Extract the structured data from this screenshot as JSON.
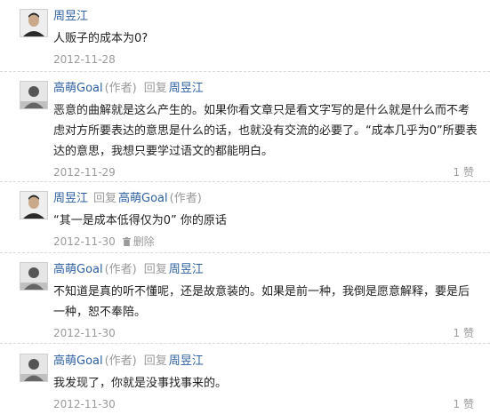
{
  "comments": [
    {
      "author": "周昱江",
      "role": "",
      "reply_word": "",
      "reply_to": "",
      "reply_to_role": "",
      "text": "人贩子的成本为0?",
      "date": "2012-11-28",
      "delete_label": "",
      "likes": ""
    },
    {
      "author": "高萌Goal",
      "role": "(作者)",
      "reply_word": "回复",
      "reply_to": "周昱江",
      "reply_to_role": "",
      "text": "恶意的曲解就是这么产生的。如果你看文章只是看文字写的是什么就是什么而不考虑对方所要表达的意思是什么的话，也就没有交流的必要了。“成本几乎为0”所要表达的意思，我想只要学过语文的都能明白。",
      "date": "2012-11-29",
      "delete_label": "",
      "likes": "1 赞"
    },
    {
      "author": "周昱江",
      "role": "",
      "reply_word": "回复",
      "reply_to": "高萌Goal",
      "reply_to_role": "(作者)",
      "text": "“其一是成本低得仅为0” 你的原话",
      "date": "2012-11-30",
      "delete_label": "删除",
      "likes": ""
    },
    {
      "author": "高萌Goal",
      "role": "(作者)",
      "reply_word": "回复",
      "reply_to": "周昱江",
      "reply_to_role": "",
      "text": "不知道是真的听不懂呢，还是故意装的。如果是前一种，我倒是愿意解释，要是后一种，恕不奉陪。",
      "date": "2012-11-30",
      "delete_label": "",
      "likes": "1 赞"
    },
    {
      "author": "高萌Goal",
      "role": "(作者)",
      "reply_word": "回复",
      "reply_to": "周昱江",
      "reply_to_role": "",
      "text": "我发现了，你就是没事找事来的。",
      "date": "2012-11-30",
      "delete_label": "",
      "likes": "1 赞"
    }
  ]
}
